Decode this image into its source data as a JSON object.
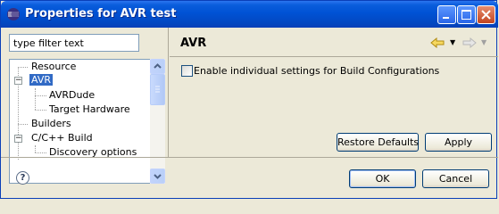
{
  "window": {
    "title": "Properties for AVR test"
  },
  "filter": {
    "placeholder": "type filter text"
  },
  "tree": {
    "items": [
      {
        "label": "Resource"
      },
      {
        "label": "AVR",
        "selected": true,
        "expander": "−"
      },
      {
        "label": "AVRDude"
      },
      {
        "label": "Target Hardware"
      },
      {
        "label": "Builders"
      },
      {
        "label": "C/C++ Build",
        "expander": "−"
      },
      {
        "label": "Discovery options"
      }
    ]
  },
  "page": {
    "title": "AVR",
    "checkbox_label": "Enable individual settings for Build Configurations",
    "checkbox_checked": false
  },
  "buttons": {
    "restore_defaults": "Restore Defaults",
    "apply": "Apply",
    "ok": "OK",
    "cancel": "Cancel"
  },
  "help": {
    "glyph": "?"
  },
  "colors": {
    "titlebar": "#0052d4",
    "selection": "#316ac5",
    "nav_arrow": "#e0b020"
  }
}
